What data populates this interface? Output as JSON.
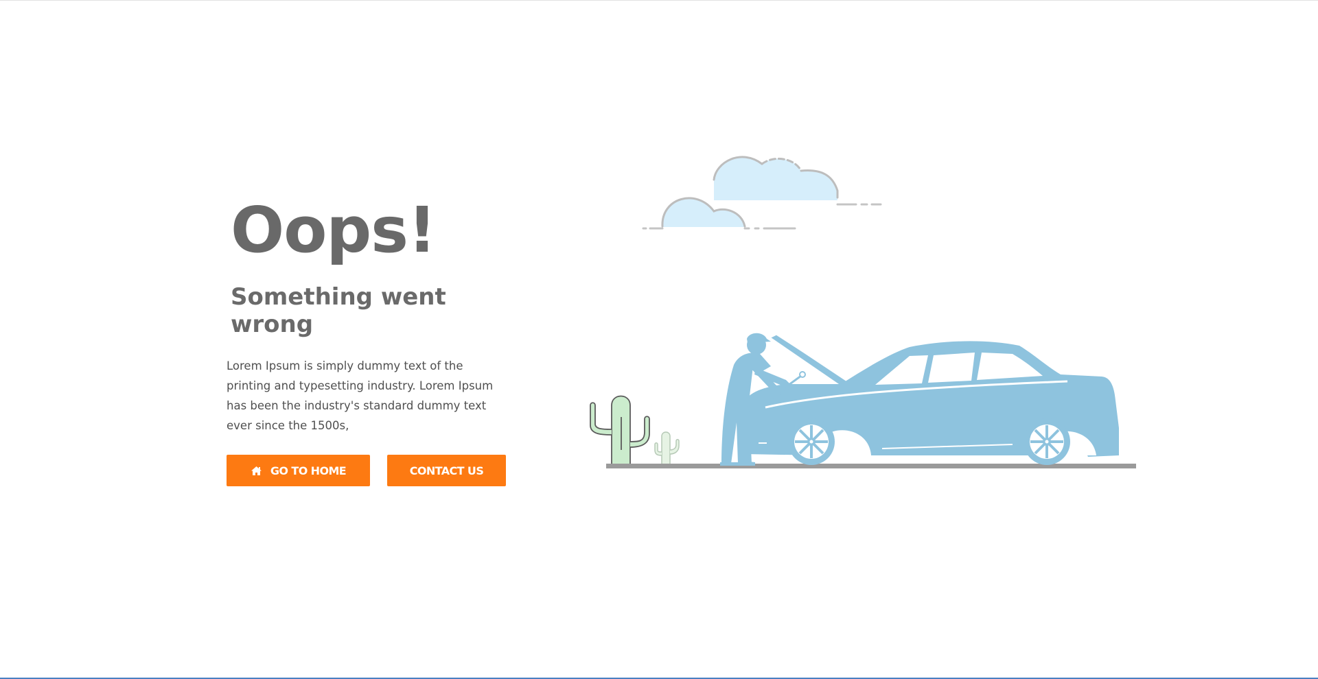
{
  "hero": {
    "title": "Oops!",
    "subtitle": "Something went wrong",
    "description": "Lorem Ipsum is simply dummy text of the printing and typesetting industry. Lorem Ipsum has been the industry's standard dummy text ever since the 1500s,"
  },
  "actions": {
    "home_label": "GO TO HOME",
    "home_icon": "home-icon",
    "contact_label": "CONTACT US"
  },
  "colors": {
    "accent": "#fd7a12",
    "heading": "#696969",
    "body_text": "#4f4f4f",
    "car": "#8ec3de",
    "cloud_fill": "#d6eefb",
    "cactus_fill": "#cbeccd",
    "ground": "#9a9a9a"
  }
}
